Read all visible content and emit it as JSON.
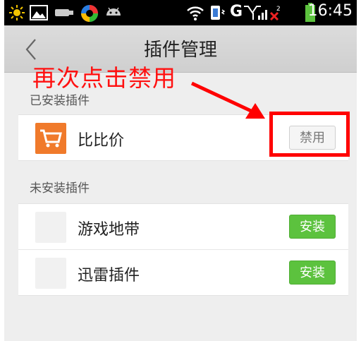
{
  "status_bar": {
    "network_letter": "G",
    "time": "16:45",
    "icons": [
      "sun-icon",
      "image-icon",
      "usb-icon",
      "app-icon",
      "android-icon",
      "wifi-icon",
      "vibrate-icon",
      "signal-icon",
      "battery-icon"
    ]
  },
  "title_bar": {
    "title": "插件管理",
    "back_icon": "chevron-left-icon"
  },
  "annotation": {
    "text": "再次点击禁用",
    "color": "#ff1111"
  },
  "installed_section": {
    "header": "已安装插件",
    "items": [
      {
        "name": "比比价",
        "action_label": "禁用",
        "icon": "shopping-cart-icon"
      }
    ]
  },
  "uninstalled_section": {
    "header": "未安装插件",
    "items": [
      {
        "name": "游戏地带",
        "action_label": "安装"
      },
      {
        "name": "迅雷插件",
        "action_label": "安装"
      }
    ]
  },
  "colors": {
    "install_button": "#5cc23e",
    "app_icon_orange": "#f07a2b",
    "annotation_red": "#ff0000"
  }
}
